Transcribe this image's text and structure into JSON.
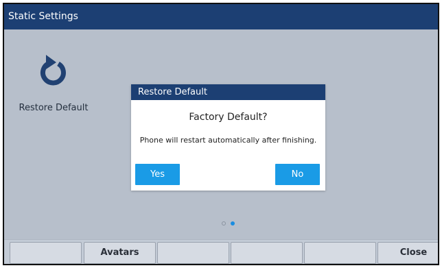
{
  "window": {
    "title": "Static Settings"
  },
  "app_tile": {
    "label": "Restore Default",
    "icon": "restore-arrow-icon"
  },
  "dialog": {
    "header": "Restore Default",
    "title": "Factory Default?",
    "message": "Phone will restart automatically after finishing.",
    "yes_label": "Yes",
    "no_label": "No"
  },
  "pagination": {
    "current_page": 2,
    "total_pages": 2
  },
  "softkeys": [
    {
      "label": ""
    },
    {
      "label": "Avatars"
    },
    {
      "label": ""
    },
    {
      "label": ""
    },
    {
      "label": ""
    },
    {
      "label": "Close"
    }
  ],
  "colors": {
    "title_bar": "#1c3f73",
    "background": "#c3cbd6",
    "accent_button": "#1a9be6",
    "icon": "#1c3f73"
  }
}
